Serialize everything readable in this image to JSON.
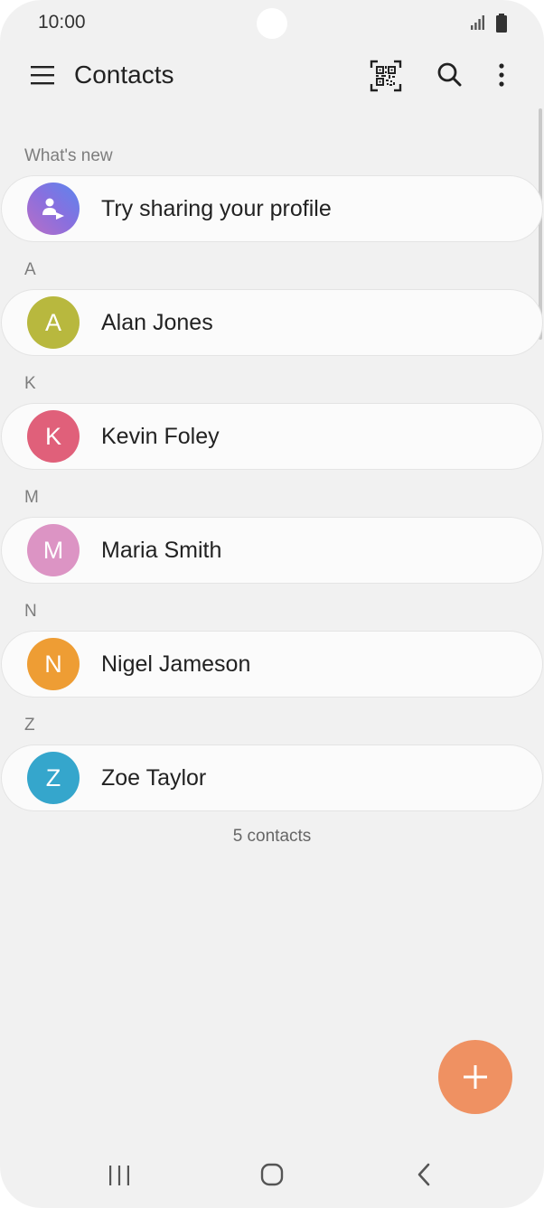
{
  "status": {
    "time": "10:00"
  },
  "appbar": {
    "title": "Contacts",
    "icons": [
      "menu-icon",
      "qr-code-icon",
      "search-icon",
      "more-options-icon"
    ]
  },
  "whats_new": {
    "header": "What's new",
    "item_label": "Try sharing your profile"
  },
  "contacts": [
    {
      "section": "A",
      "name": "Alan Jones",
      "initial": "A",
      "color": "#b8b83e"
    },
    {
      "section": "K",
      "name": "Kevin Foley",
      "initial": "K",
      "color": "#e0607a"
    },
    {
      "section": "M",
      "name": "Maria Smith",
      "initial": "M",
      "color": "#dc94c4"
    },
    {
      "section": "N",
      "name": "Nigel Jameson",
      "initial": "N",
      "color": "#ee9d34"
    },
    {
      "section": "Z",
      "name": "Zoe Taylor",
      "initial": "Z",
      "color": "#35a6cc"
    }
  ],
  "footer": {
    "count_text": "5 contacts"
  },
  "colors": {
    "background": "#f1f1f1",
    "fab": "#ef9162",
    "card": "#fbfbfb"
  },
  "navbar": {
    "icons": [
      "recents-icon",
      "home-icon",
      "back-icon"
    ]
  }
}
